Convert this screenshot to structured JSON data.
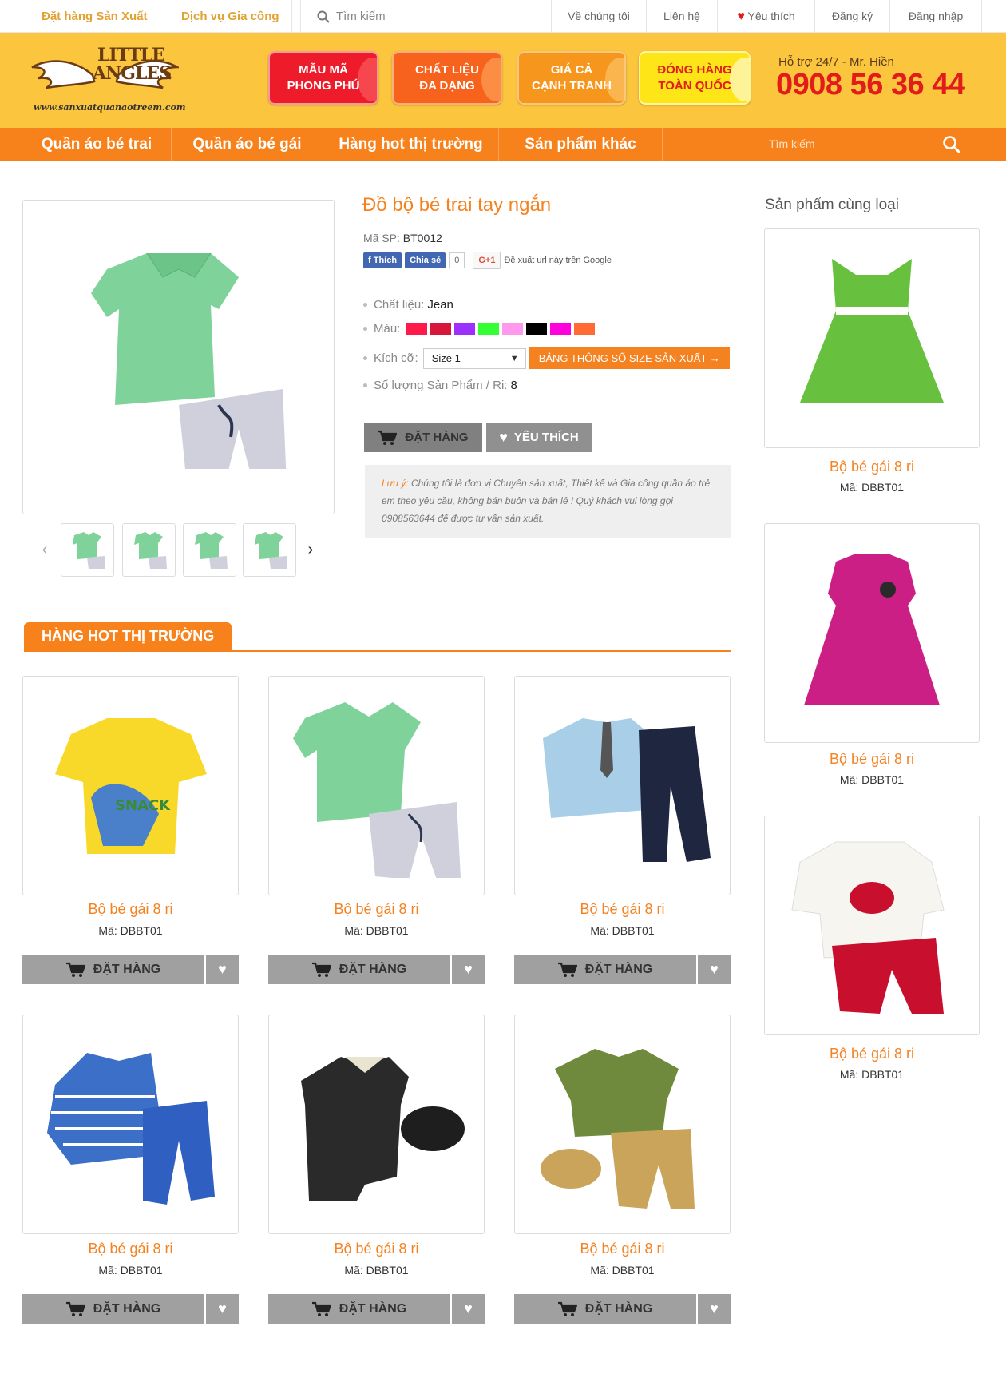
{
  "topbar": {
    "left_links": [
      "Đặt hàng Sản Xuất",
      "Dịch vụ Gia công"
    ],
    "search_placeholder": "Tìm kiếm",
    "right_links": [
      "Về chúng tôi",
      "Liên hệ",
      "Yêu thích",
      "Đăng ký",
      "Đăng nhập"
    ]
  },
  "header": {
    "logo_line1": "LITTLE",
    "logo_line2": "ANGLES",
    "logo_url": "www.sanxuatquanaotreem.com",
    "badges": [
      {
        "line1": "MẪU MÃ",
        "line2": "PHONG PHÚ",
        "color": "#ee1c2b"
      },
      {
        "line1": "CHẤT LIỆU",
        "line2": "ĐA DẠNG",
        "color": "#f7821c"
      },
      {
        "line1": "GIÁ CẢ",
        "line2": "CẠNH TRANH",
        "color": "#f7961c"
      },
      {
        "line1": "ĐÓNG HÀNG",
        "line2": "TOÀN QUỐC",
        "color": "#fde517"
      }
    ],
    "hotline_label": "Hỗ trợ 24/7 - Mr. Hiền",
    "hotline": "0908 56 36 44"
  },
  "nav": {
    "items": [
      "Quần áo bé trai",
      "Quần áo bé gái",
      "Hàng hot thị trường",
      "Sản phẩm khác"
    ],
    "search_placeholder": "Tìm kiếm"
  },
  "product": {
    "title": "Đồ bộ bé trai tay ngắn",
    "code_label": "Mã SP:",
    "code": "BT0012",
    "social": {
      "like": "Thích",
      "share": "Chia sẻ",
      "count": "0",
      "gplus": "G+1",
      "gplus_note": "Đề xuất url này trên Google"
    },
    "material_label": "Chất liệu:",
    "material": "Jean",
    "color_label": "Màu:",
    "colors": [
      "#ff1a4b",
      "#d6163a",
      "#9b30ff",
      "#33ff33",
      "#ff99ee",
      "#000000",
      "#ff00dd",
      "#ff6b33"
    ],
    "size_label": "Kích cỡ:",
    "size_selected": "Size 1",
    "size_button": "BẢNG THÔNG SỐ SIZE SẢN XUẤT →",
    "qty_label": "Số lượng Sản Phẩm / Ri:",
    "qty": "8",
    "order_button": "ĐẶT HÀNG",
    "fav_button": "YÊU THÍCH",
    "note_label": "Lưu ý:",
    "note_text": "Chúng tôi là đơn vị Chuyên sản xuất, Thiết kế và Gia công quần áo trẻ em theo yêu cầu, không bán buôn và bán lẻ ! Quý khách vui lòng gọi 0908563644 để được tư vấn sản xuất."
  },
  "hot_section": {
    "title": "HÀNG HOT THỊ TRƯỜNG",
    "items": [
      {
        "name": "Bộ bé gái 8 ri",
        "code": "Mã: DBBT01",
        "order": "ĐẶT HÀNG",
        "image": "yellow-shark-tshirt"
      },
      {
        "name": "Bộ bé gái 8 ri",
        "code": "Mã: DBBT01",
        "order": "ĐẶT HÀNG",
        "image": "green-polo-shorts"
      },
      {
        "name": "Bộ bé gái 8 ri",
        "code": "Mã: DBBT01",
        "order": "ĐẶT HÀNG",
        "image": "blue-shirt-tie-navy-pants"
      },
      {
        "name": "Bộ bé gái 8 ri",
        "code": "Mã: DBBT01",
        "order": "ĐẶT HÀNG",
        "image": "striped-jacket-blue-pants"
      },
      {
        "name": "Bộ bé gái 8 ri",
        "code": "Mã: DBBT01",
        "order": "ĐẶT HÀNG",
        "image": "black-romper-cap"
      },
      {
        "name": "Bộ bé gái 8 ri",
        "code": "Mã: DBBT01",
        "order": "ĐẶT HÀNG",
        "image": "olive-polo-khaki-pants-hat"
      }
    ]
  },
  "sidebar": {
    "title": "Sản phẩm cùng loại",
    "items": [
      {
        "name": "Bộ bé gái 8 ri",
        "code": "Mã: DBBT01",
        "image": "green-polka-dress"
      },
      {
        "name": "Bộ bé gái 8 ri",
        "code": "Mã: DBBT01",
        "image": "pink-dress"
      },
      {
        "name": "Bộ bé gái 8 ri",
        "code": "Mã: DBBT01",
        "image": "ladybug-pajamas"
      }
    ]
  },
  "colors": {
    "accent": "#f7821c",
    "header_bg": "#fcc53e",
    "hotline": "#e21b1b"
  }
}
